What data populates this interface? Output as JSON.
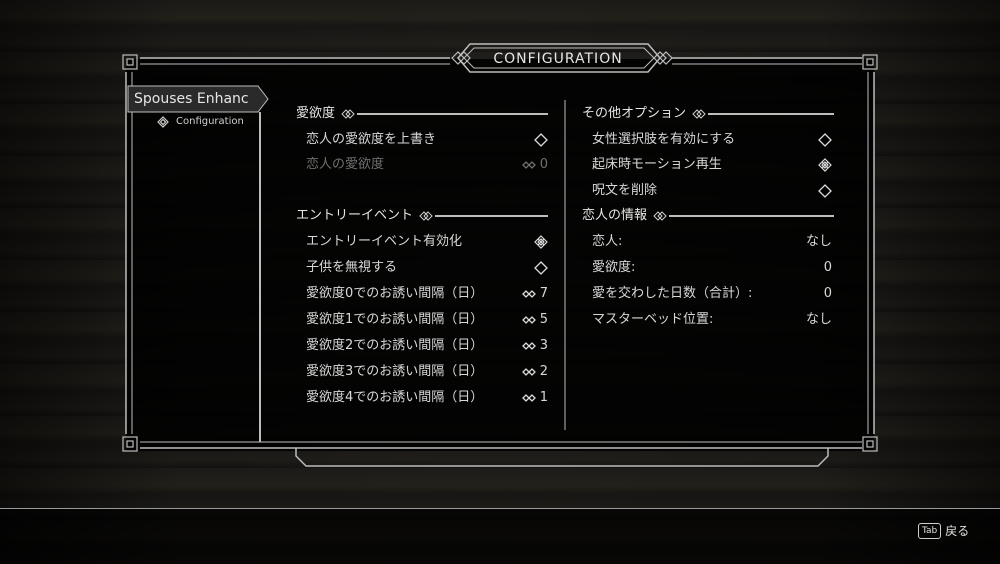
{
  "header": {
    "title": "CONFIGURATION"
  },
  "sidebar": {
    "mod_name": "Spouses Enhanc",
    "page": "Configuration"
  },
  "left": {
    "section1": {
      "title": "愛欲度",
      "rows": [
        {
          "label": "恋人の愛欲度を上書き",
          "type": "toggle",
          "checked": false
        },
        {
          "label": "恋人の愛欲度",
          "type": "slider",
          "value": "0",
          "disabled": true
        }
      ]
    },
    "section2": {
      "title": "エントリーイベント",
      "rows": [
        {
          "label": "エントリーイベント有効化",
          "type": "toggle",
          "checked": true
        },
        {
          "label": "子供を無視する",
          "type": "toggle",
          "checked": false
        },
        {
          "label": "愛欲度0でのお誘い間隔（日）",
          "type": "slider",
          "value": "7"
        },
        {
          "label": "愛欲度1でのお誘い間隔（日）",
          "type": "slider",
          "value": "5"
        },
        {
          "label": "愛欲度2でのお誘い間隔（日）",
          "type": "slider",
          "value": "3"
        },
        {
          "label": "愛欲度3でのお誘い間隔（日）",
          "type": "slider",
          "value": "2"
        },
        {
          "label": "愛欲度4でのお誘い間隔（日）",
          "type": "slider",
          "value": "1"
        }
      ]
    }
  },
  "right": {
    "section1": {
      "title": "その他オプション",
      "rows": [
        {
          "label": "女性選択肢を有効にする",
          "type": "toggle",
          "checked": false
        },
        {
          "label": "起床時モーション再生",
          "type": "toggle",
          "checked": true
        },
        {
          "label": "呪文を削除",
          "type": "toggle",
          "checked": false
        }
      ]
    },
    "section2": {
      "title": "恋人の情報",
      "rows": [
        {
          "label": "恋人:",
          "value": "なし"
        },
        {
          "label": "愛欲度:",
          "value": "0"
        },
        {
          "label": "愛を交わした日数（合計）:",
          "value": "0"
        },
        {
          "label": "マスターベッド位置:",
          "value": "なし"
        }
      ]
    }
  },
  "footer": {
    "key": "Tab",
    "action": "戻る"
  }
}
